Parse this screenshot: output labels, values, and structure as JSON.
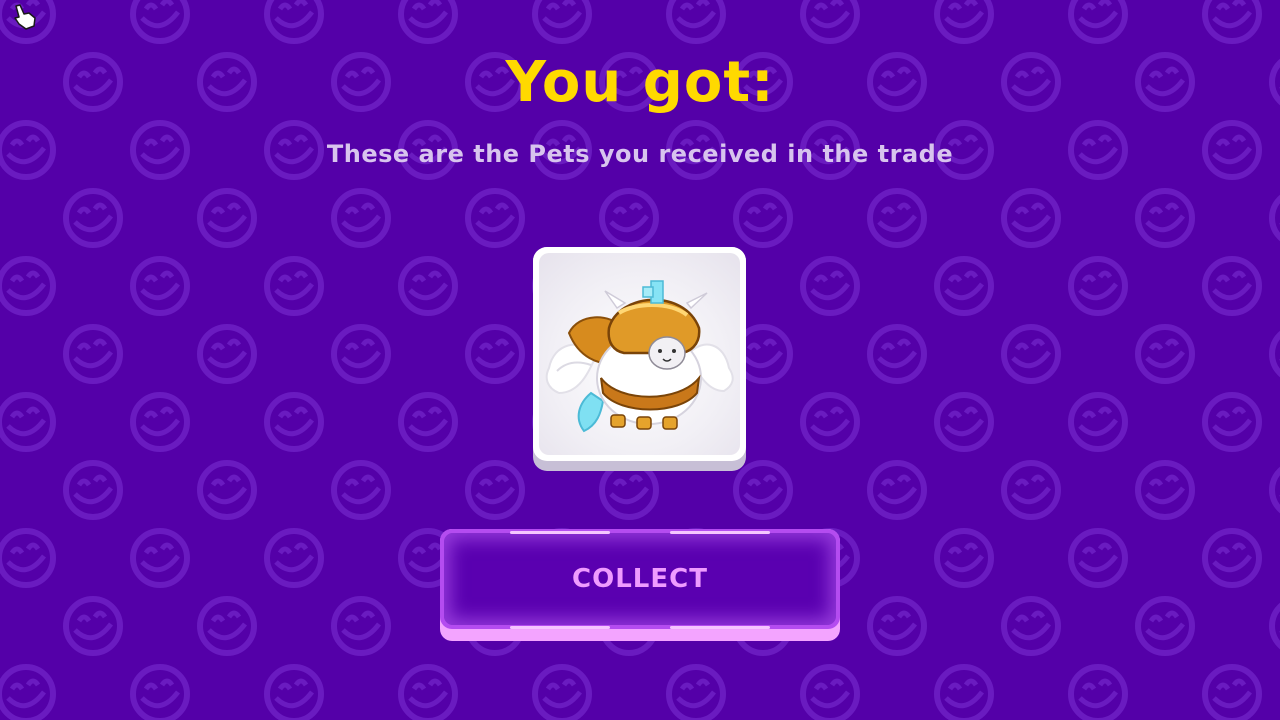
{
  "title": "You got:",
  "subtitle": "These are the Pets you received in the trade",
  "pet": {
    "icon": "armored-golden-pet-icon"
  },
  "collect_button": {
    "label": "COLLECT"
  },
  "colors": {
    "background": "#5400a8",
    "title": "#ffd900",
    "subtitle": "#d8c4ee",
    "button_face": "#5a00b0",
    "button_label": "#ef9bff"
  }
}
